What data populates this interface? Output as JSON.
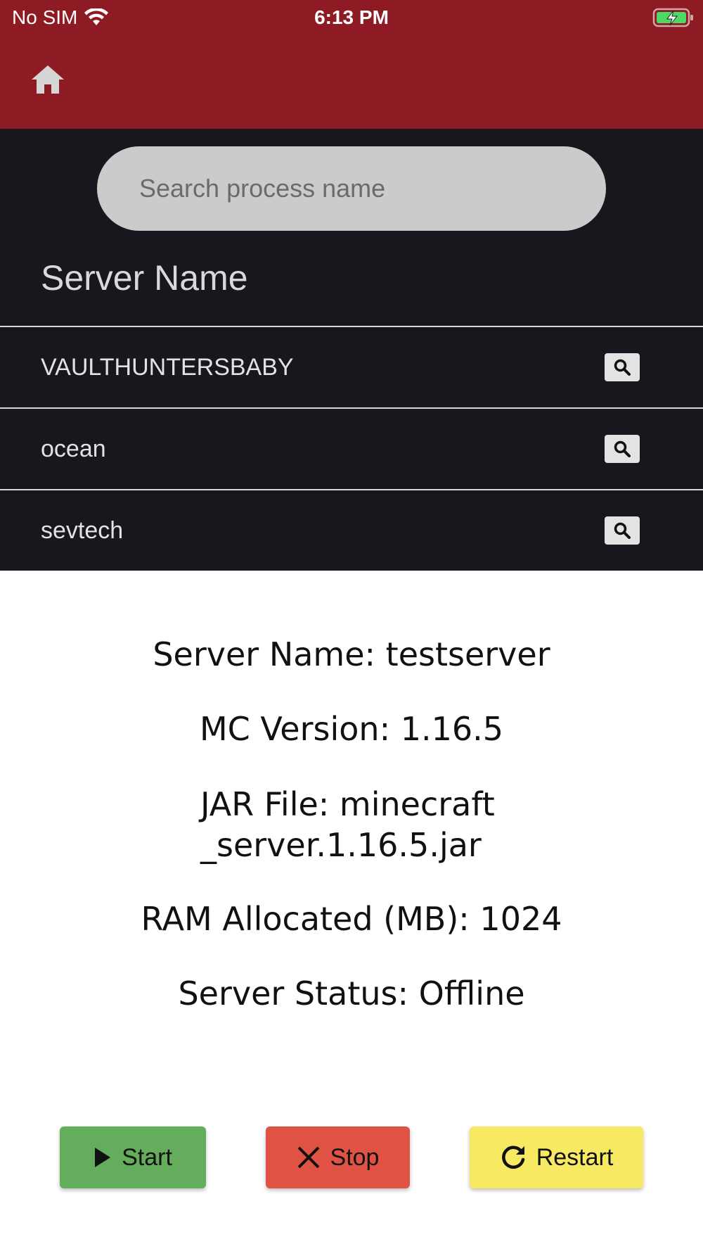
{
  "status_bar": {
    "carrier": "No SIM",
    "time": "6:13 PM",
    "wifi_icon": "wifi-icon",
    "battery_icon": "battery-charging-icon",
    "battery_color": "#4cd964"
  },
  "header": {
    "background": "#8e1b24",
    "home_icon": "home-icon"
  },
  "search": {
    "placeholder": "Search process name",
    "value": ""
  },
  "server_list": {
    "column_header": "Server Name",
    "rows": [
      {
        "name": "VAULTHUNTERSBABY",
        "action_icon": "search-icon"
      },
      {
        "name": "ocean",
        "action_icon": "search-icon"
      },
      {
        "name": "sevtech",
        "action_icon": "search-icon"
      }
    ]
  },
  "details": {
    "server_name": "Server Name: testserver",
    "mc_version": "MC Version: 1.16.5",
    "jar_file_line1": "JAR File: minecraft",
    "jar_file_line2": "_server.1.16.5.jar",
    "ram": "RAM Allocated (MB): 1024",
    "status": "Server Status: Offline"
  },
  "actions": {
    "start": {
      "label": "Start",
      "icon": "play-icon",
      "color": "#63ad5c"
    },
    "stop": {
      "label": "Stop",
      "icon": "close-icon",
      "color": "#e05344"
    },
    "restart": {
      "label": "Restart",
      "icon": "refresh-icon",
      "color": "#f8e963"
    }
  }
}
